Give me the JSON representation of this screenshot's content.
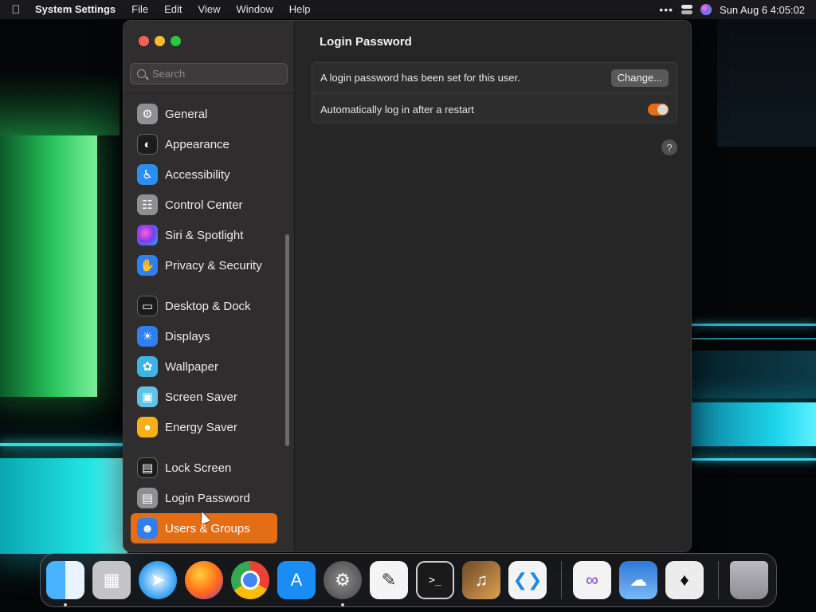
{
  "menubar": {
    "app_name": "System Settings",
    "menus": [
      "File",
      "Edit",
      "View",
      "Window",
      "Help"
    ],
    "datetime": "Sun Aug 6  4:05:02"
  },
  "sidebar": {
    "search_placeholder": "Search",
    "items": [
      {
        "label": "General",
        "icon": "gear-icon"
      },
      {
        "label": "Appearance",
        "icon": "appearance-icon"
      },
      {
        "label": "Accessibility",
        "icon": "accessibility-icon"
      },
      {
        "label": "Control Center",
        "icon": "control-center-icon"
      },
      {
        "label": "Siri & Spotlight",
        "icon": "siri-icon"
      },
      {
        "label": "Privacy & Security",
        "icon": "hand-icon"
      },
      {
        "label": "Desktop & Dock",
        "icon": "desktop-icon"
      },
      {
        "label": "Displays",
        "icon": "sun-icon"
      },
      {
        "label": "Wallpaper",
        "icon": "wallpaper-icon"
      },
      {
        "label": "Screen Saver",
        "icon": "screen-saver-icon"
      },
      {
        "label": "Energy Saver",
        "icon": "bulb-icon"
      },
      {
        "label": "Lock Screen",
        "icon": "lock-icon"
      },
      {
        "label": "Login Password",
        "icon": "lock-icon"
      },
      {
        "label": "Users & Groups",
        "icon": "users-icon",
        "selected": true
      }
    ]
  },
  "content": {
    "title": "Login Password",
    "row1_text": "A login password has been set for this user.",
    "change_button": "Change...",
    "row2_text": "Automatically log in after a restart",
    "auto_login_enabled": true,
    "help_label": "?"
  },
  "dock": {
    "apps": [
      "Finder",
      "Launchpad",
      "Safari",
      "Firefox",
      "Chrome",
      "App Store",
      "System Settings",
      "TextEdit",
      "Terminal",
      "GarageBand",
      "Visual Studio Code",
      "Visual Studio",
      "Weather",
      "Tuxedo",
      "Trash"
    ]
  },
  "colors": {
    "accent": "#e46e15",
    "window_bg": "#262626",
    "sidebar_bg": "#2f2d2d"
  }
}
